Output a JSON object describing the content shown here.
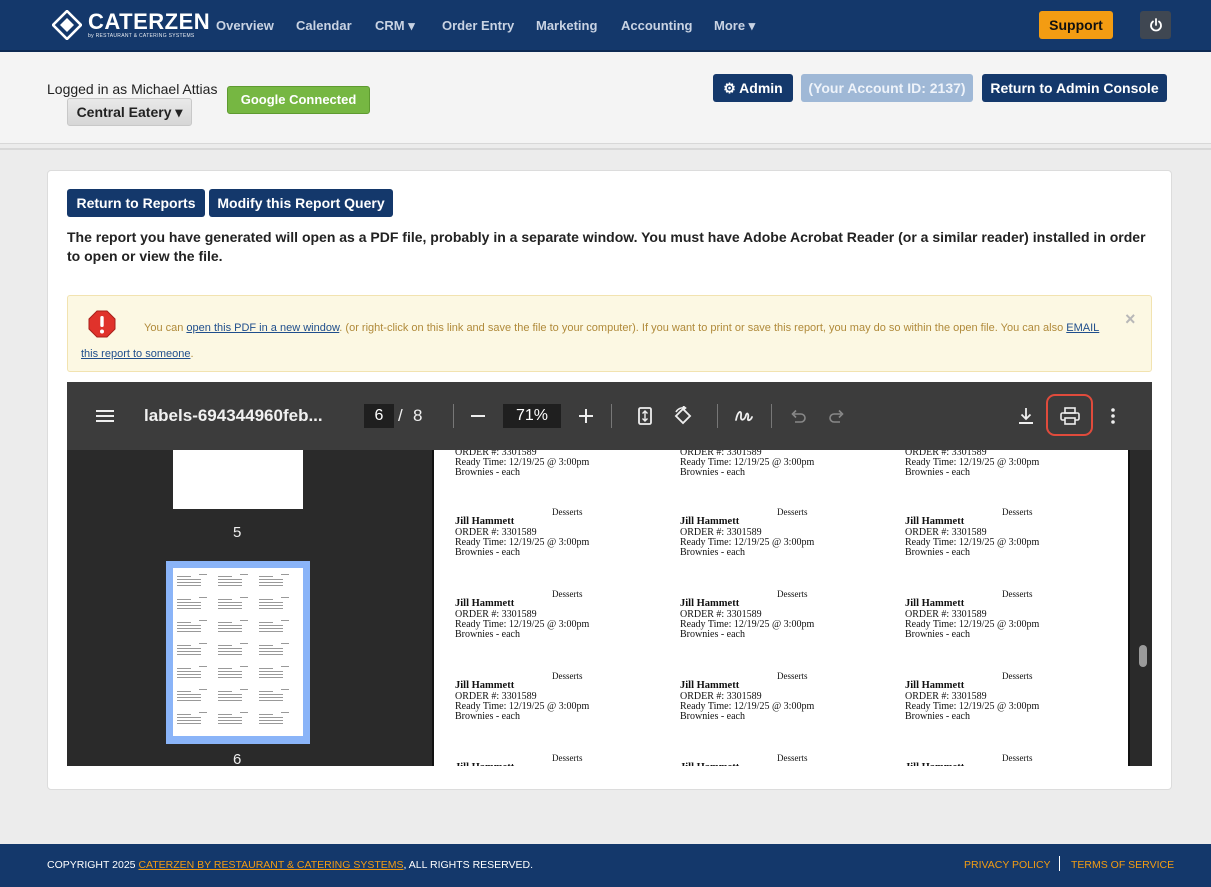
{
  "brand": {
    "name": "CATERZEN",
    "tagline": "by RESTAURANT & CATERING SYSTEMS"
  },
  "nav": {
    "items": [
      {
        "label": "Overview"
      },
      {
        "label": "Calendar"
      },
      {
        "label": "CRM ▾"
      },
      {
        "label": "Order Entry"
      },
      {
        "label": "Marketing"
      },
      {
        "label": "Accounting"
      },
      {
        "label": "More ▾"
      }
    ],
    "support_label": "Support",
    "power_icon": "power-icon"
  },
  "header": {
    "logged_in": "Logged in as Michael Attias",
    "location": "Central Eatery ▾",
    "google": "Google Connected",
    "admin": "⚙ Admin",
    "account_id": "(Your Account ID: 2137)",
    "return_admin": "Return to Admin Console"
  },
  "main": {
    "return_reports": "Return to Reports",
    "modify_query": "Modify this Report Query",
    "description": "The report you have generated will open as a PDF file, probably in a separate window. You must have Adobe Acrobat Reader (or a similar reader) installed in order to open or view the file."
  },
  "alert": {
    "prefix": "You can ",
    "link1": "open this PDF in a new window",
    "middle": ". (or right-click on this link and save the file to your computer). If you want to print or save this report, you may do so within the open file. You can also ",
    "link2": "EMAIL this report to someone",
    "suffix": ".",
    "close": "×"
  },
  "pdf": {
    "filename": "labels-694344960feb...",
    "current_page": "6",
    "page_sep": "/",
    "total_pages": "8",
    "zoom": "71%",
    "thumbnails": [
      {
        "num": "5"
      },
      {
        "num": "6"
      }
    ],
    "top_partial": {
      "order": "ORDER #: 3301589",
      "ready": "Ready Time: 12/19/25 @ 3:00pm",
      "item": "Brownies  - each"
    },
    "label": {
      "category": "Desserts",
      "name": "Jill Hammett",
      "order": "ORDER #: 3301589",
      "ready": "Ready Time: 12/19/25 @ 3:00pm",
      "item": "Brownies  - each"
    }
  },
  "footer": {
    "copyright_prefix": "COPYRIGHT 2025 ",
    "copyright_link": "CATERZEN BY RESTAURANT & CATERING SYSTEMS",
    "copyright_suffix": ", ALL RIGHTS RESERVED.",
    "privacy": "PRIVACY POLICY",
    "terms": "TERMS OF SERVICE"
  },
  "colors": {
    "nav_bg": "#14386b",
    "support": "#f39c12",
    "google": "#76b742",
    "alert_bg": "#fcf8e3",
    "print_highlight": "#e04b3c"
  }
}
